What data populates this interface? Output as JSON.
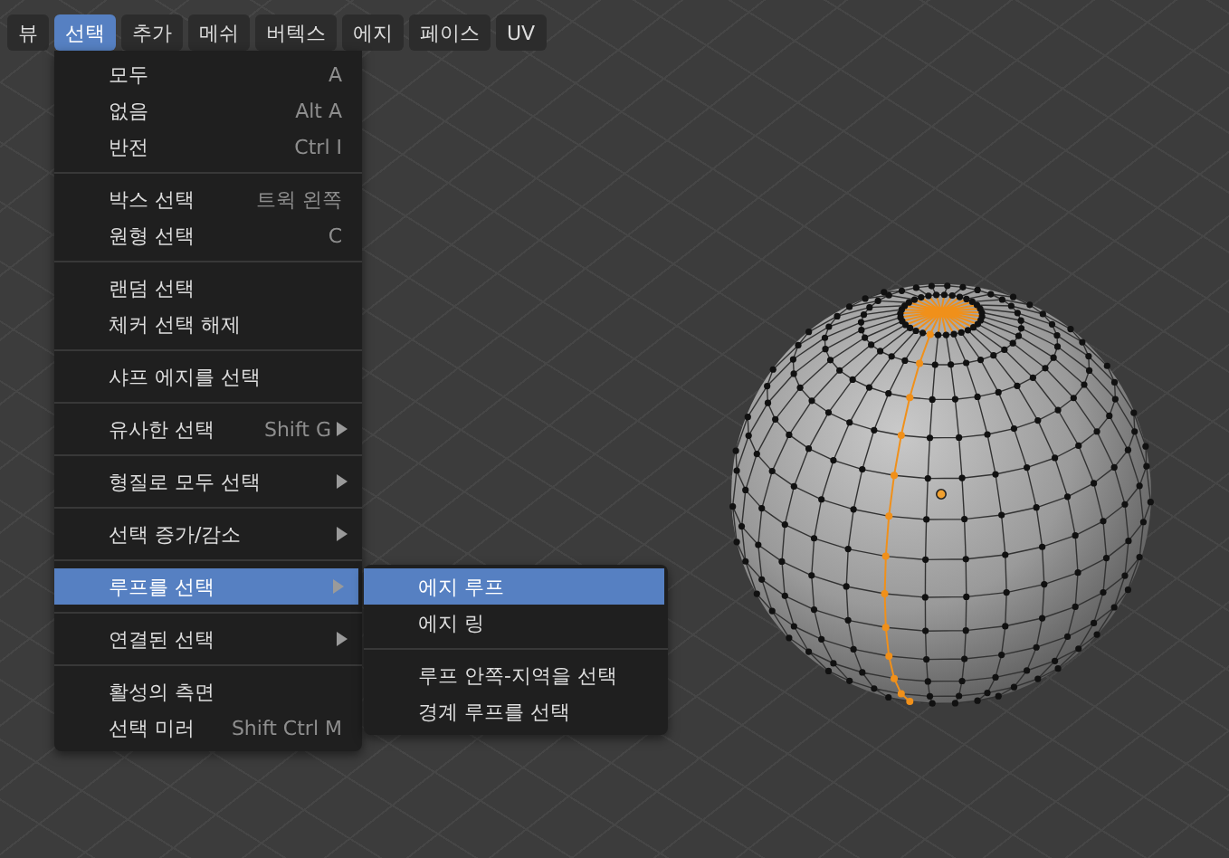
{
  "menubar": [
    {
      "label": "뷰",
      "selected": false
    },
    {
      "label": "선택",
      "selected": true
    },
    {
      "label": "추가",
      "selected": false
    },
    {
      "label": "메쉬",
      "selected": false
    },
    {
      "label": "버텍스",
      "selected": false
    },
    {
      "label": "에지",
      "selected": false
    },
    {
      "label": "페이스",
      "selected": false
    },
    {
      "label": "UV",
      "selected": false
    }
  ],
  "menu": {
    "groups": [
      [
        {
          "label": "모두",
          "shortcut": "A",
          "submenu": false,
          "selected": false
        },
        {
          "label": "없음",
          "shortcut": "Alt A",
          "submenu": false,
          "selected": false
        },
        {
          "label": "반전",
          "shortcut": "Ctrl I",
          "submenu": false,
          "selected": false
        }
      ],
      [
        {
          "label": "박스 선택",
          "shortcut": "트윅 왼쪽",
          "submenu": false,
          "selected": false
        },
        {
          "label": "원형 선택",
          "shortcut": "C",
          "submenu": false,
          "selected": false
        }
      ],
      [
        {
          "label": "랜덤 선택",
          "submenu": false,
          "selected": false
        },
        {
          "label": "체커 선택 해제",
          "submenu": false,
          "selected": false
        }
      ],
      [
        {
          "label": "샤프 에지를 선택",
          "submenu": false,
          "selected": false
        }
      ],
      [
        {
          "label": "유사한 선택",
          "shortcut": "Shift G",
          "submenu": true,
          "selected": false
        }
      ],
      [
        {
          "label": "형질로 모두 선택",
          "submenu": true,
          "selected": false
        }
      ],
      [
        {
          "label": "선택 증가/감소",
          "submenu": true,
          "selected": false
        }
      ],
      [
        {
          "label": "루프를 선택",
          "submenu": true,
          "selected": true
        }
      ],
      [
        {
          "label": "연결된 선택",
          "submenu": true,
          "selected": false
        }
      ],
      [
        {
          "label": "활성의 측면",
          "submenu": false,
          "selected": false
        },
        {
          "label": "선택 미러",
          "shortcut": "Shift Ctrl M",
          "submenu": false,
          "selected": false
        }
      ]
    ]
  },
  "submenu": {
    "groups": [
      [
        {
          "label": "에지 루프",
          "selected": true
        },
        {
          "label": "에지 링",
          "selected": false
        }
      ],
      [
        {
          "label": "루프 안쪽-지역을 선택",
          "selected": false
        },
        {
          "label": "경계 루프를 선택",
          "selected": false
        }
      ]
    ]
  }
}
